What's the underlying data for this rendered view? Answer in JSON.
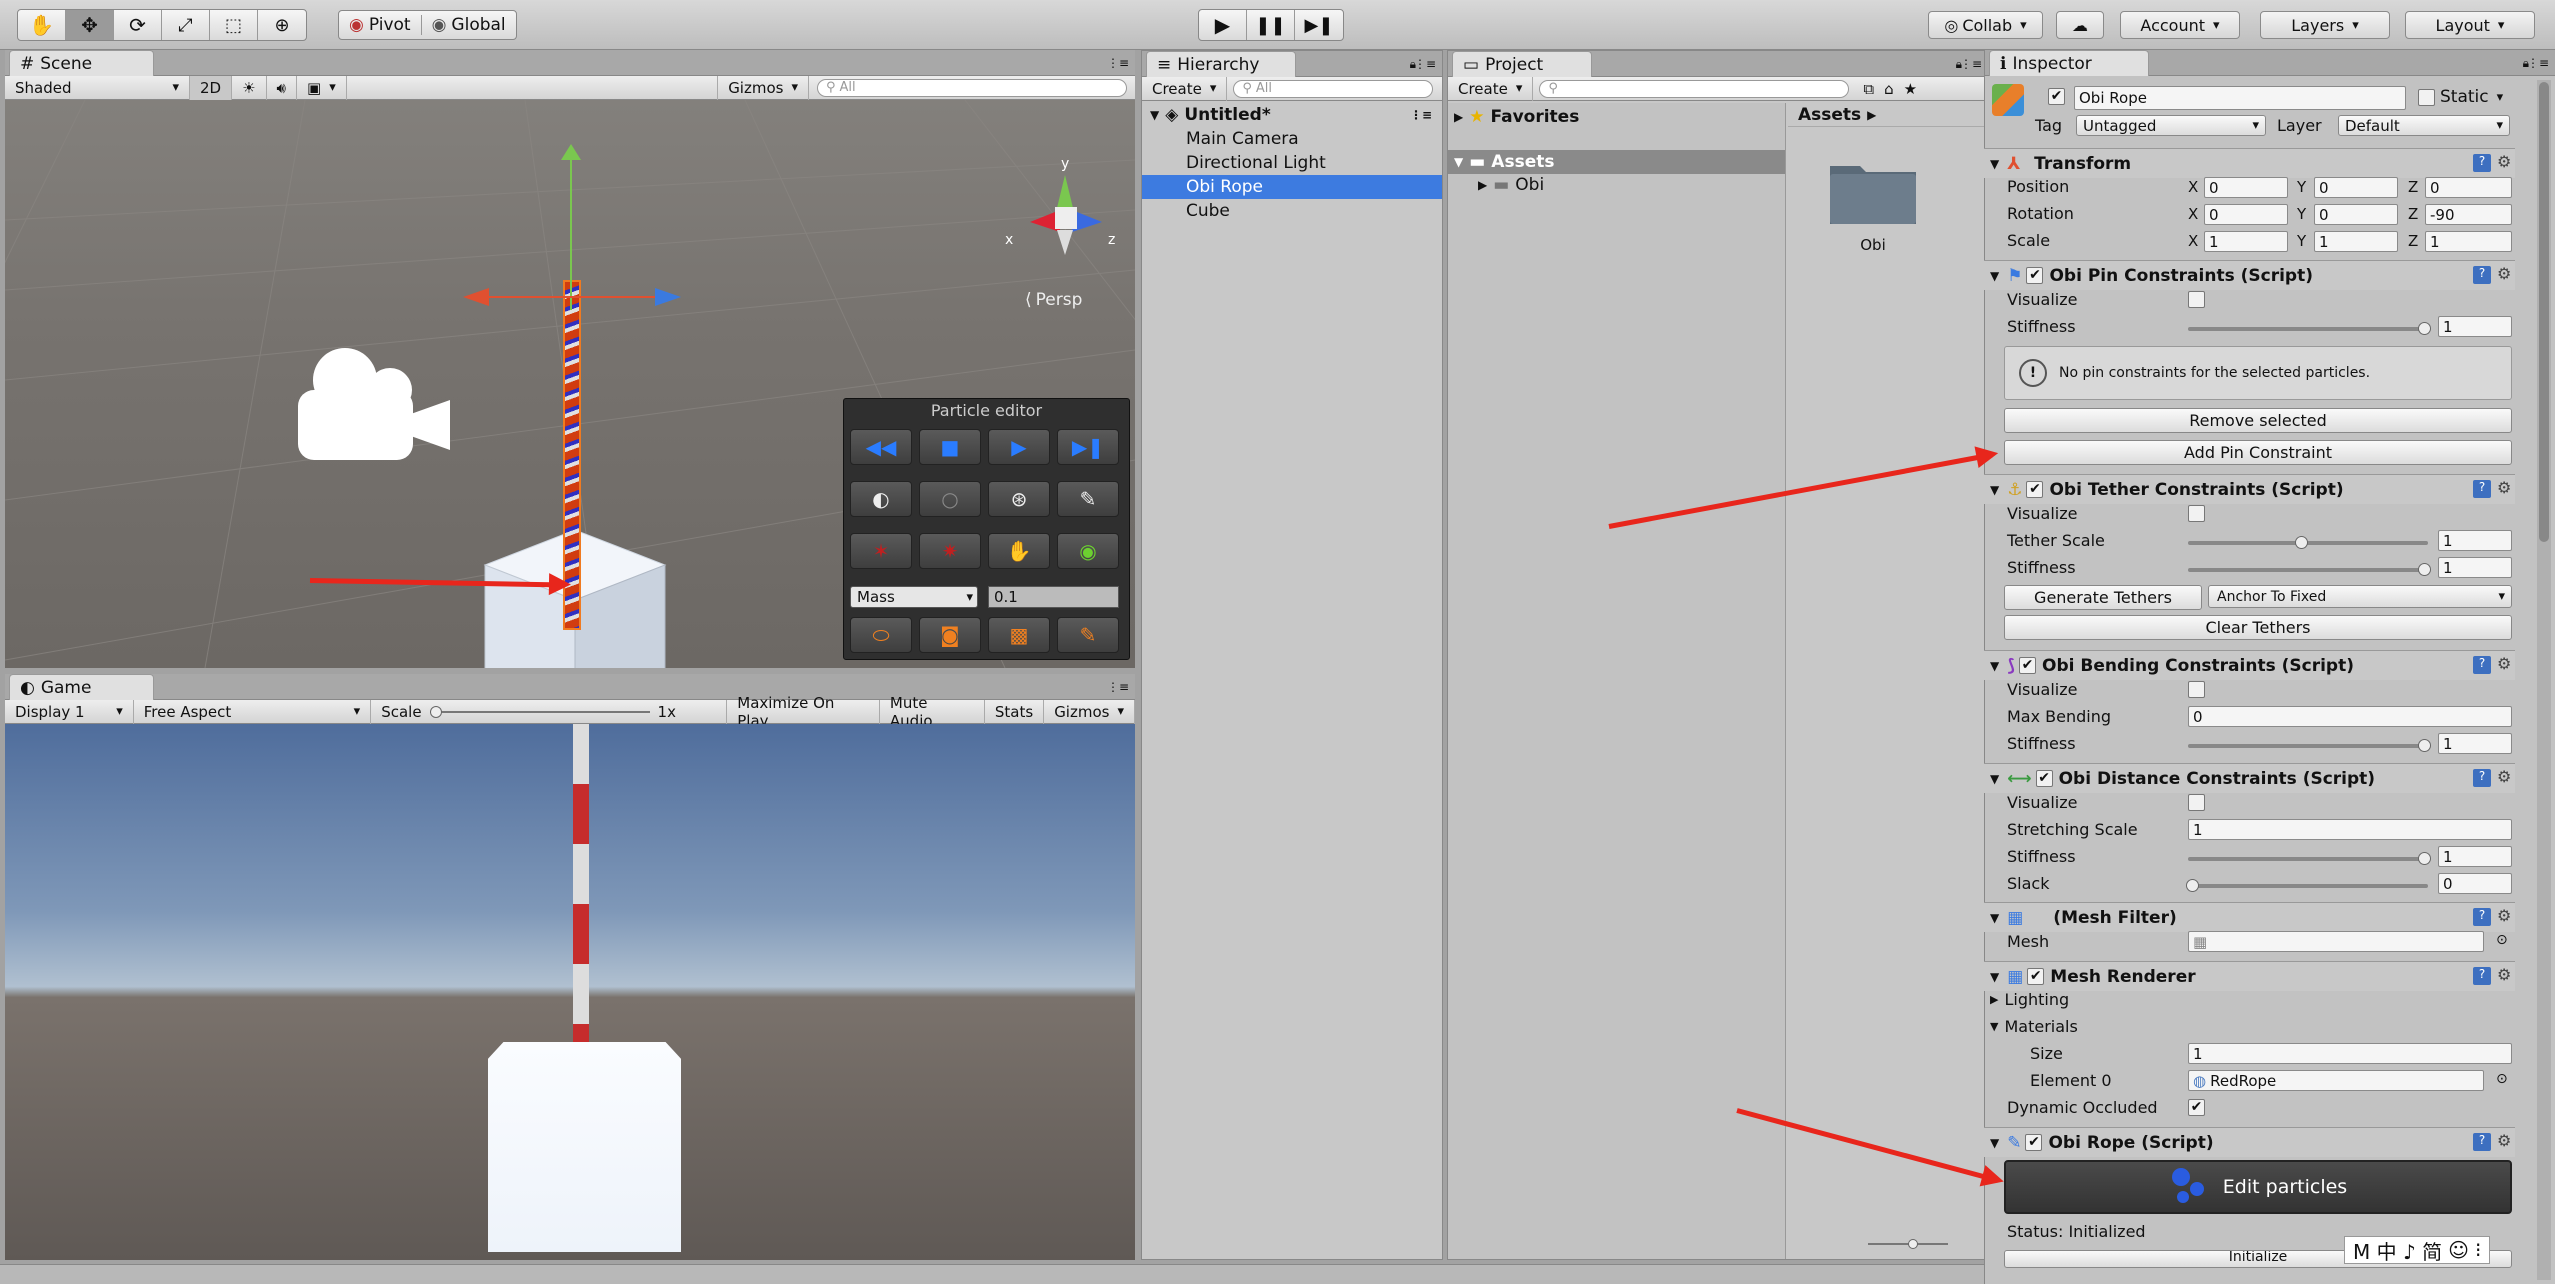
{
  "toolbar": {
    "pivot": "Pivot",
    "global": "Global",
    "collab": "Collab",
    "account": "Account",
    "layers": "Layers",
    "layout": "Layout"
  },
  "scene": {
    "tab": "Scene",
    "shading": "Shaded",
    "mode2d": "2D",
    "gizmos": "Gizmos",
    "search_placeholder": "All",
    "persp": "Persp",
    "axes": {
      "x": "x",
      "y": "y",
      "z": "z"
    }
  },
  "particle_editor": {
    "title": "Particle editor",
    "property": "Mass",
    "value": "0.1"
  },
  "game": {
    "tab": "Game",
    "display": "Display 1",
    "aspect": "Free Aspect",
    "scale_label": "Scale",
    "scale_value": "1x",
    "maximize": "Maximize On Play",
    "mute": "Mute Audio",
    "stats": "Stats",
    "gizmos": "Gizmos"
  },
  "hierarchy": {
    "tab": "Hierarchy",
    "create": "Create",
    "search_placeholder": "All",
    "scene_name": "Untitled*",
    "items": [
      "Main Camera",
      "Directional Light",
      "Obi Rope",
      "Cube"
    ]
  },
  "project": {
    "tab": "Project",
    "create": "Create",
    "favorites": "Favorites",
    "assets": "Assets",
    "obi_folder": "Obi",
    "breadcrumb": "Assets",
    "grid_folder": "Obi"
  },
  "inspector": {
    "tab": "Inspector",
    "object_name": "Obi Rope",
    "static": "Static",
    "tag_label": "Tag",
    "tag_value": "Untagged",
    "layer_label": "Layer",
    "layer_value": "Default",
    "transform": {
      "title": "Transform",
      "position_label": "Position",
      "rotation_label": "Rotation",
      "scale_label": "Scale",
      "position": [
        "0",
        "0",
        "0"
      ],
      "rotation": [
        "0",
        "0",
        "-90"
      ],
      "scale": [
        "1",
        "1",
        "1"
      ]
    },
    "pin": {
      "title": "Obi Pin Constraints (Script)",
      "visualize": "Visualize",
      "stiffness": "Stiffness",
      "stiffness_value": "1",
      "info": "No pin constraints for the selected particles.",
      "remove": "Remove selected",
      "add": "Add Pin Constraint"
    },
    "tether": {
      "title": "Obi Tether Constraints (Script)",
      "visualize": "Visualize",
      "tether_scale": "Tether Scale",
      "tether_scale_value": "1",
      "stiffness": "Stiffness",
      "stiffness_value": "1",
      "generate": "Generate Tethers",
      "anchor": "Anchor To Fixed",
      "clear": "Clear Tethers"
    },
    "bending": {
      "title": "Obi Bending Constraints (Script)",
      "visualize": "Visualize",
      "max_bending": "Max Bending",
      "max_bending_value": "0",
      "stiffness": "Stiffness",
      "stiffness_value": "1"
    },
    "distance": {
      "title": "Obi Distance Constraints (Script)",
      "visualize": "Visualize",
      "stretching": "Stretching Scale",
      "stretching_value": "1",
      "stiffness": "Stiffness",
      "stiffness_value": "1",
      "slack": "Slack",
      "slack_value": "0"
    },
    "mesh_filter": {
      "title": "(Mesh Filter)",
      "mesh": "Mesh"
    },
    "mesh_renderer": {
      "title": "Mesh Renderer",
      "lighting": "Lighting",
      "materials": "Materials",
      "size": "Size",
      "size_value": "1",
      "element0": "Element 0",
      "element0_value": "RedRope",
      "dynamic_occluded": "Dynamic Occluded"
    },
    "obi_rope": {
      "title": "Obi Rope (Script)",
      "edit": "Edit particles",
      "status": "Status: Initialized",
      "initialize": "Initialize"
    }
  },
  "ime": {
    "text": "M 中 ♪ 简"
  },
  "colors": {
    "accent_red": "#e8261c",
    "selection": "#3d7be0"
  }
}
